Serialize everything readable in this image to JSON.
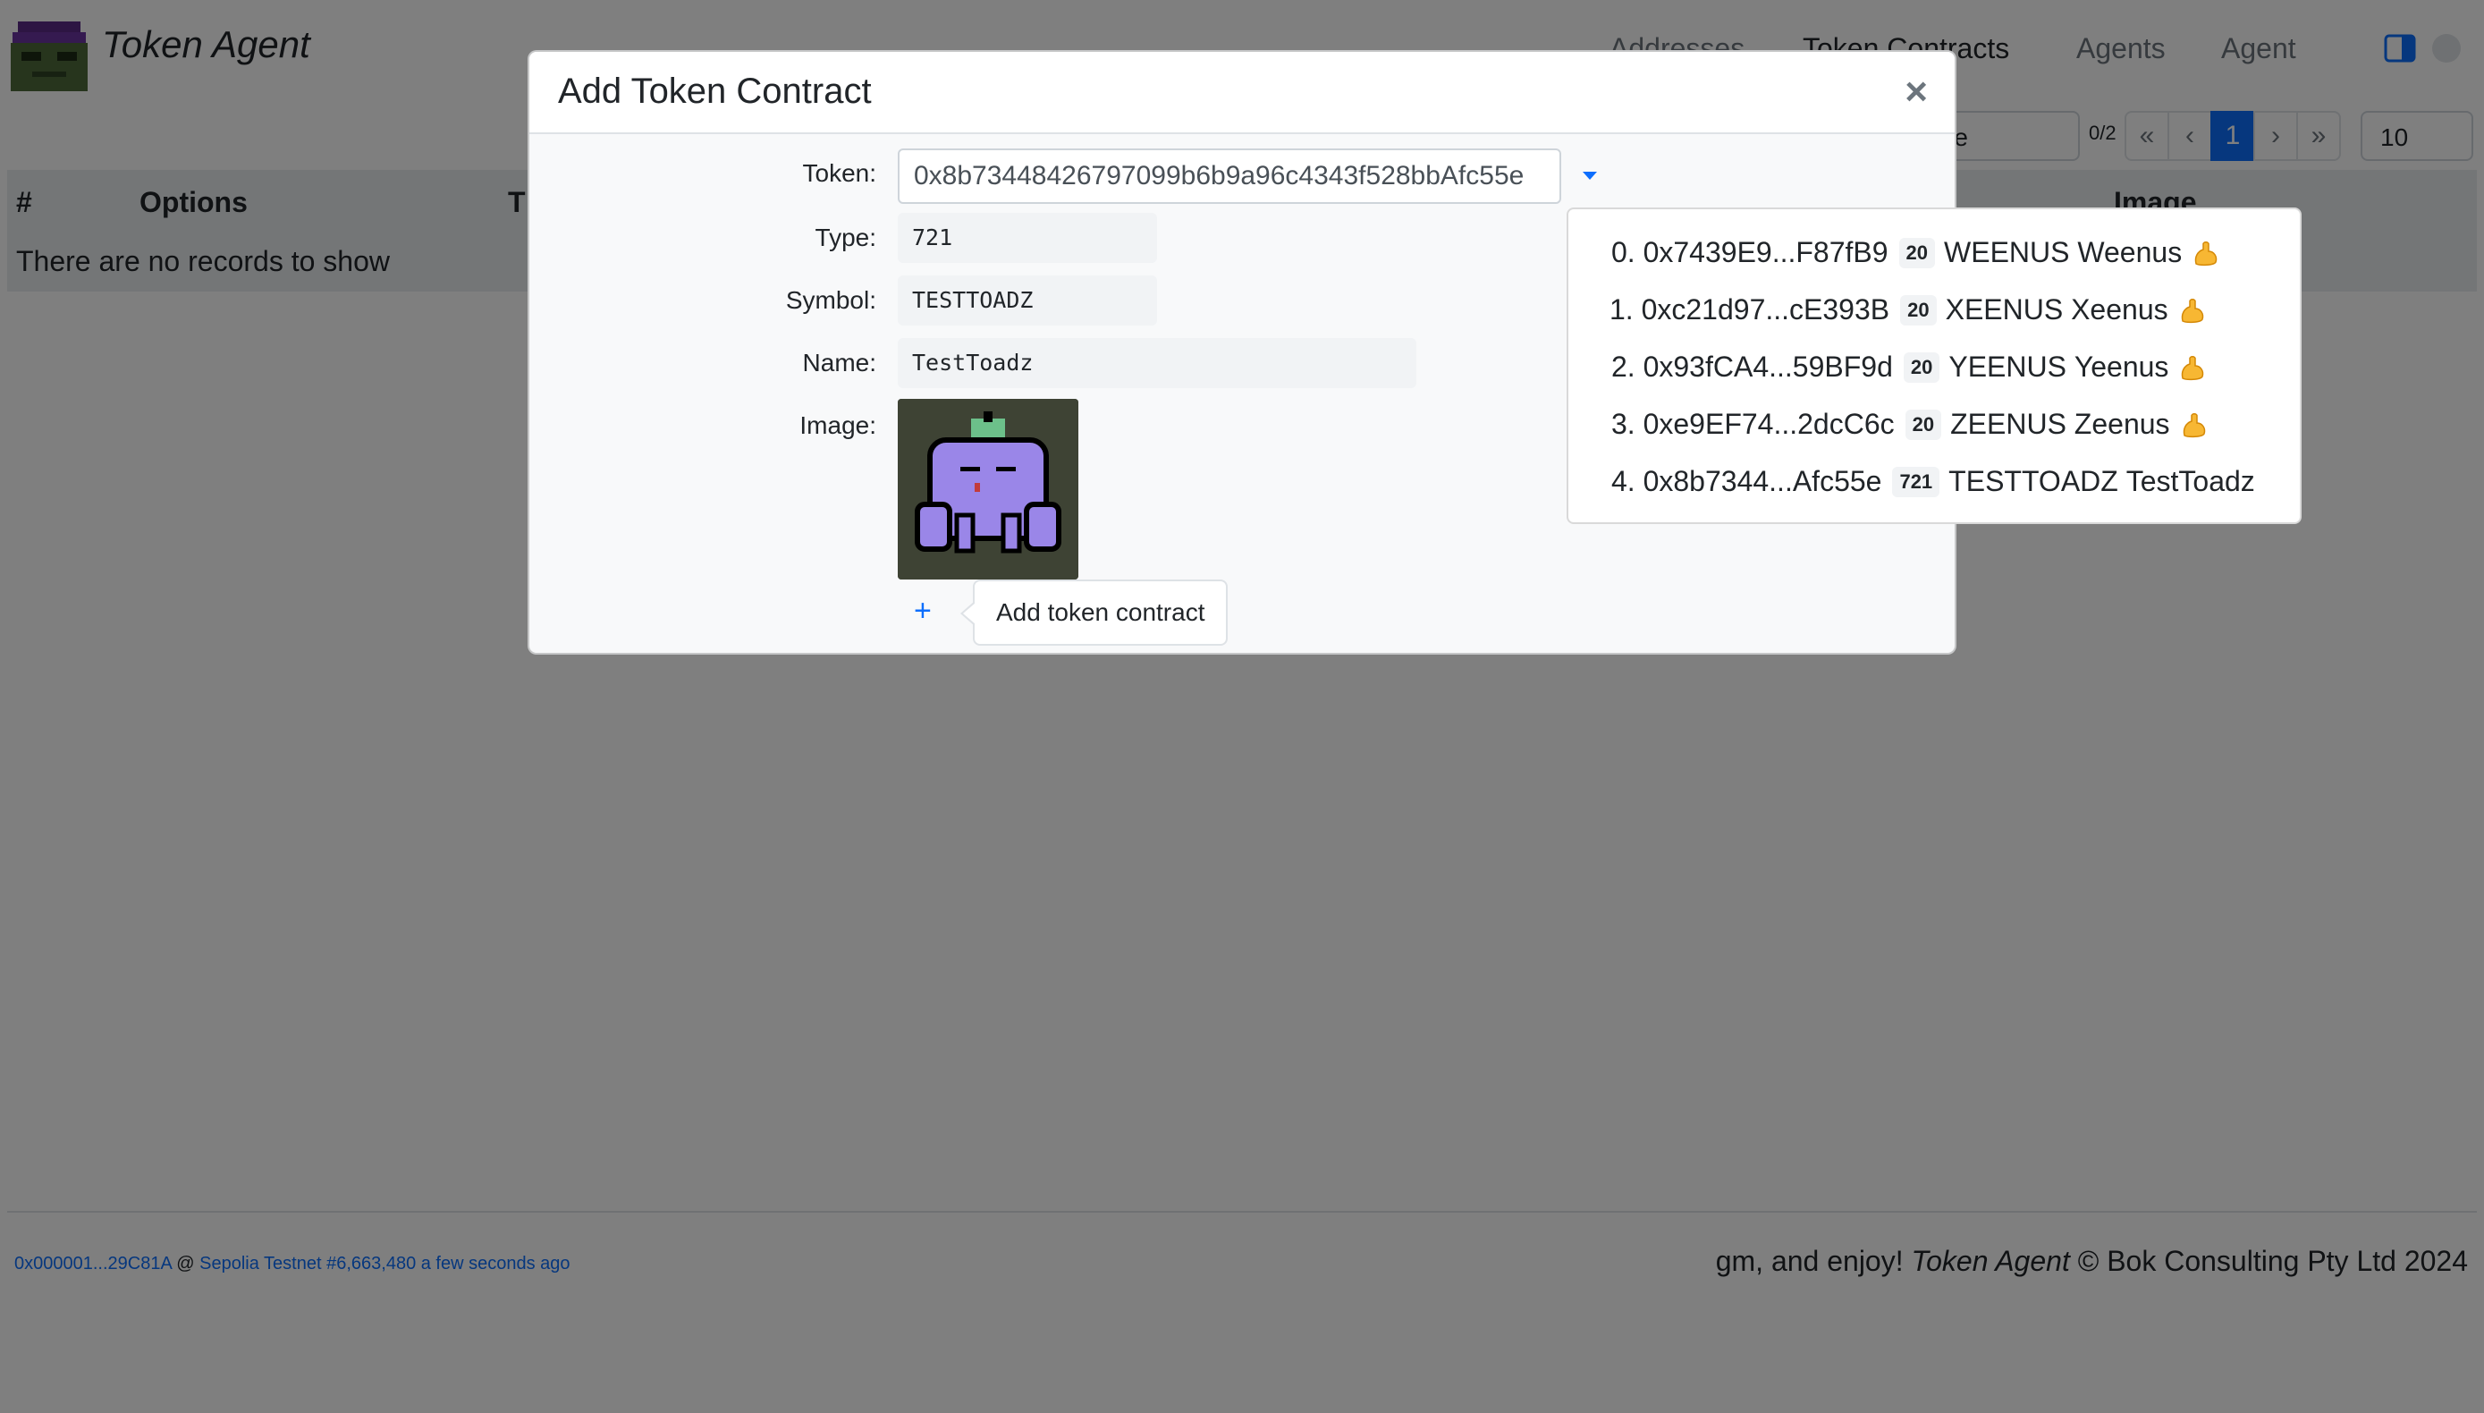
{
  "app": {
    "title": "Token Agent"
  },
  "nav": {
    "items": [
      {
        "label": "Addresses",
        "active": false
      },
      {
        "label": "Token Contracts",
        "active": true
      },
      {
        "label": "Agents",
        "active": false
      },
      {
        "label": "Agent",
        "active": false
      }
    ]
  },
  "pagination": {
    "sort_select": "me",
    "count": "0/2",
    "first": "«",
    "prev": "‹",
    "current": "1",
    "next": "›",
    "last": "»",
    "page_size": "10"
  },
  "table": {
    "headers": [
      "#",
      "Options",
      "T",
      "Image"
    ],
    "empty_text": "There are no records to show"
  },
  "modal": {
    "title": "Add Token Contract",
    "close": "×",
    "labels": {
      "token": "Token:",
      "type": "Type:",
      "symbol": "Symbol:",
      "name": "Name:",
      "image": "Image:"
    },
    "token_value": "0x8b73448426797099b6b9a96c4343f528bbAfc55e",
    "type_value": "721",
    "symbol_value": "TESTTOADZ",
    "name_value": "TestToadz",
    "add_plus": "+",
    "tooltip": "Add token contract"
  },
  "dropdown": {
    "items": [
      {
        "index": "0.",
        "address": "0x7439E9...F87fB9",
        "type": "20",
        "symbol": "WEENUS",
        "name": "Weenus",
        "emoji": "flexed-biceps"
      },
      {
        "index": "1.",
        "address": "0xc21d97...cE393B",
        "type": "20",
        "symbol": "XEENUS",
        "name": "Xeenus",
        "emoji": "flexed-biceps"
      },
      {
        "index": "2.",
        "address": "0x93fCA4...59BF9d",
        "type": "20",
        "symbol": "YEENUS",
        "name": "Yeenus",
        "emoji": "flexed-biceps"
      },
      {
        "index": "3.",
        "address": "0xe9EF74...2dcC6c",
        "type": "20",
        "symbol": "ZEENUS",
        "name": "Zeenus",
        "emoji": "flexed-biceps"
      },
      {
        "index": "4.",
        "address": "0x8b7344...Afc55e",
        "type": "721",
        "symbol": "TESTTOADZ",
        "name": "TestToadz",
        "emoji": ""
      }
    ]
  },
  "footer": {
    "account": "0x000001...29C81A",
    "at": "@",
    "network": "Sepolia Testnet #6,663,480 a few seconds ago",
    "greeting": "gm, and enjoy!",
    "app_name": "Token Agent",
    "copyright": "© Bok Consulting Pty Ltd 2024"
  },
  "colors": {
    "accent": "#0d6efd",
    "backdrop": "rgba(0,0,0,0.5)"
  }
}
